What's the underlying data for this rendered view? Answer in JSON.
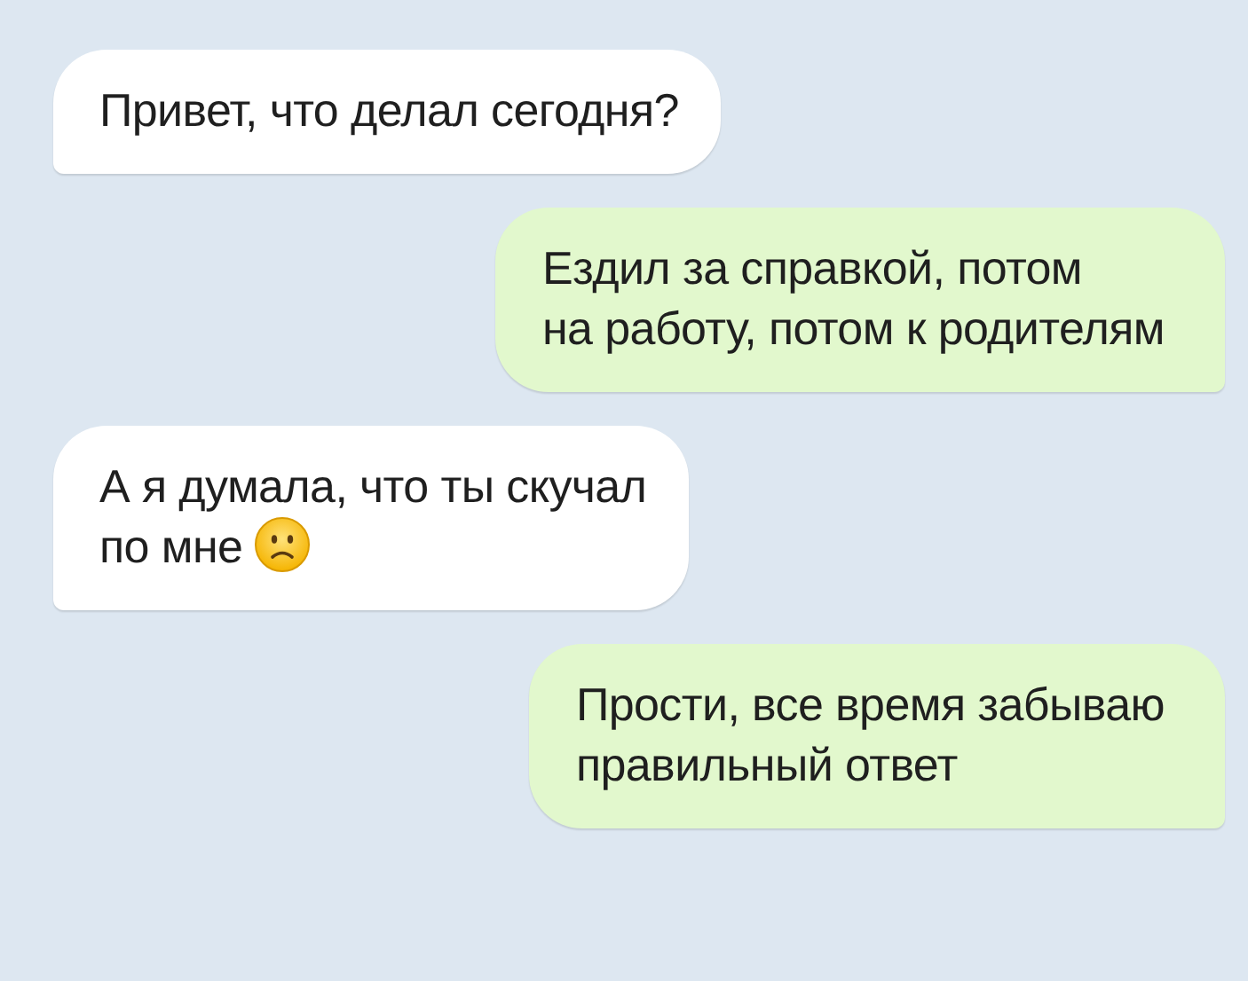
{
  "messages": [
    {
      "kind": "incoming",
      "lines": [
        "Привет, что делал сегодня?"
      ]
    },
    {
      "kind": "outgoing",
      "lines": [
        "Ездил за справкой, потом",
        "на работу, потом к родителям"
      ]
    },
    {
      "kind": "incoming",
      "lines": [
        "А я думала, что ты скучал",
        "по мне"
      ],
      "emoji": true
    },
    {
      "kind": "outgoing",
      "lines": [
        "Прости, все время забываю",
        "правильный ответ"
      ]
    }
  ]
}
